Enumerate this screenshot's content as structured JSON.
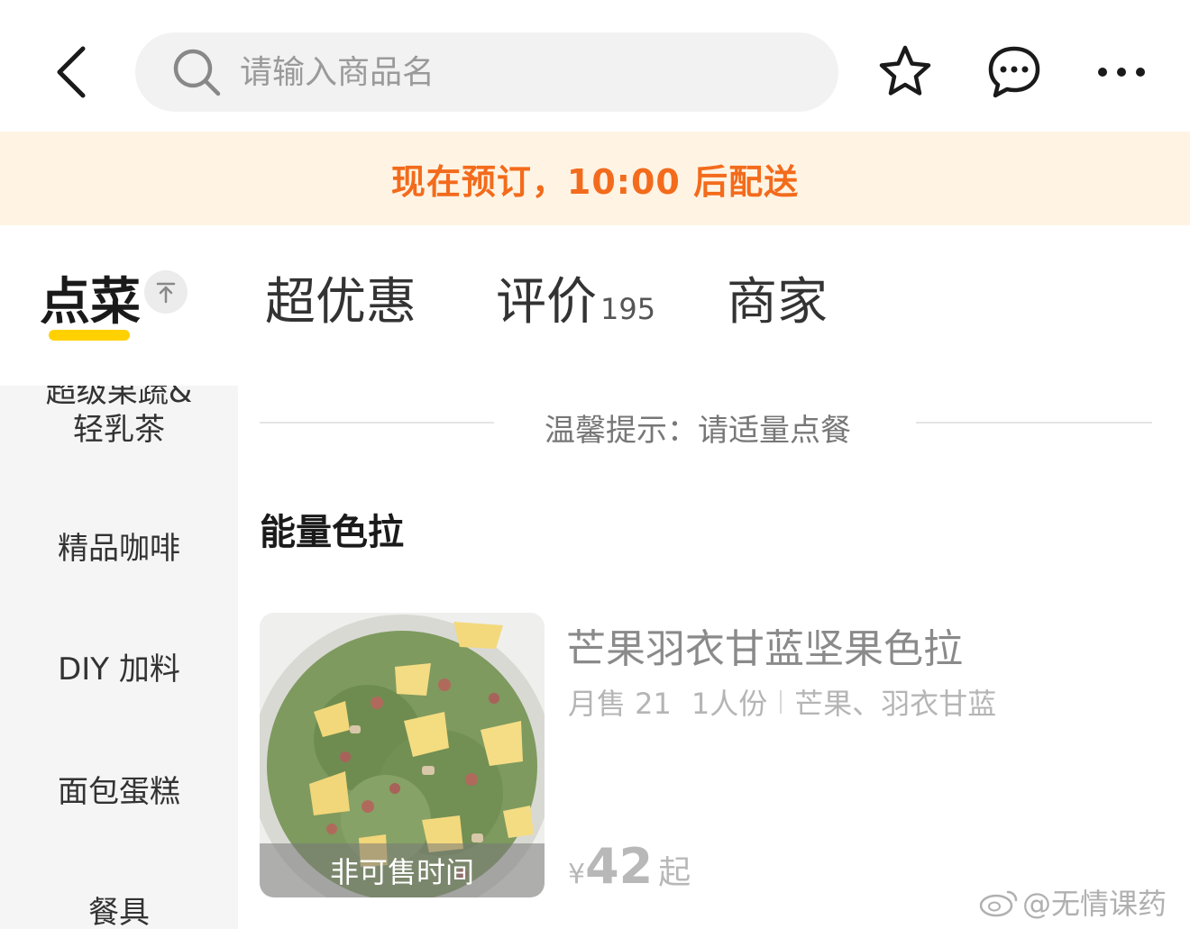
{
  "header": {
    "search_placeholder": "请输入商品名"
  },
  "icons": {
    "back": "back-arrow-icon",
    "search": "search-icon",
    "favorite": "star-icon",
    "message": "chat-bubble-icon",
    "more": "more-dots-icon",
    "pin": "pin-to-top-icon"
  },
  "notice": {
    "text": "现在预订，10:00 后配送"
  },
  "tabs": [
    {
      "label": "点菜",
      "count": ""
    },
    {
      "label": "超优惠",
      "count": ""
    },
    {
      "label": "评价",
      "count": "195"
    },
    {
      "label": "商家",
      "count": ""
    }
  ],
  "sidebar": {
    "items": [
      {
        "label": "超级果蔬&"
      },
      {
        "label": "轻乳茶"
      },
      {
        "label": "精品咖啡"
      },
      {
        "label": "DIY 加料"
      },
      {
        "label": "面包蛋糕"
      },
      {
        "label": "餐具"
      }
    ]
  },
  "main": {
    "tip": "温馨提示：请适量点餐",
    "section_title": "能量色拉",
    "product": {
      "name": "芒果羽衣甘蓝坚果色拉",
      "sales": "月售 21",
      "portion": "1人份",
      "ingredients": "芒果、羽衣甘蓝",
      "status": "非可售时间",
      "currency": "¥",
      "price": "42",
      "price_suffix": "起"
    }
  },
  "watermark": {
    "text": "@无情课药"
  },
  "colors": {
    "accent_orange": "#f36b1c",
    "notice_bg": "#fff4e3",
    "tab_underline": "#ffd100",
    "sidebar_bg": "#f5f5f5"
  }
}
